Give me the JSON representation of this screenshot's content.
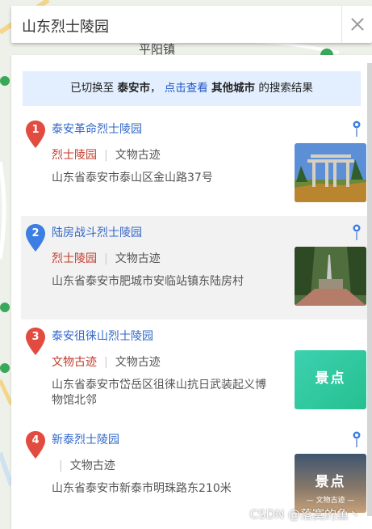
{
  "search": {
    "query": "山东烈士陵园"
  },
  "map": {
    "place_label": "平阳镇"
  },
  "notice": {
    "prefix": "已切换至",
    "city": "泰安市",
    "comma": "，",
    "link": "点击查看",
    "other": "其他城市",
    "suffix": "的搜索结果"
  },
  "results": [
    {
      "num": "1",
      "title": "泰安革命烈士陵园",
      "tag1": "烈士陵园",
      "sep": "|",
      "tag2": "文物古迹",
      "address": "山东省泰安市泰山区金山路37号",
      "marker_color": "#e24b3f"
    },
    {
      "num": "2",
      "title": "陆房战斗烈士陵园",
      "tag1": "烈士陵园",
      "sep": "|",
      "tag2": "文物古迹",
      "address": "山东省泰安市肥城市安临站镇东陆房村",
      "marker_color": "#3c7ee2"
    },
    {
      "num": "3",
      "title": "泰安徂徕山烈士陵园",
      "tag1": "文物古迹",
      "sep": "|",
      "tag2": "文物古迹",
      "address": "山东省泰安市岱岳区徂徕山抗日武装起义博物馆北邻",
      "marker_color": "#e24b3f",
      "thumb_label": "景点"
    },
    {
      "num": "4",
      "title": "新泰烈士陵园",
      "tag1": "",
      "sep": "|",
      "tag2": "文物古迹",
      "address": "山东省泰安市新泰市明珠路东210米",
      "marker_color": "#e24b3f",
      "thumb_label": "景点",
      "thumb_sub": "— 文物古迹 —"
    }
  ],
  "watermark": "CSDN @落寞的鱼丶",
  "colors": {
    "link": "#3267c9",
    "tag": "#c03a2b",
    "notice_bg": "#e3eefe",
    "highlight_row": "#f2f2f2"
  }
}
